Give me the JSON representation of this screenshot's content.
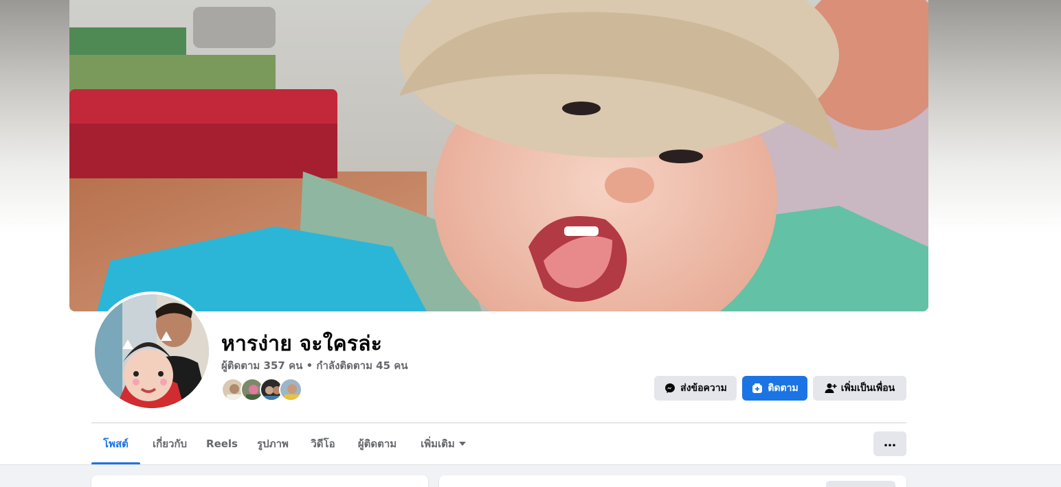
{
  "profile": {
    "name": "หารง่าย จะใครล่ะ",
    "stats": "ผู้ติดตาม 357 คน • กำลังติดตาม 45 คน",
    "friend_faces": [
      {
        "label": "friend-1",
        "color": "#d9c9b4"
      },
      {
        "label": "friend-2",
        "color": "#7c8a6a"
      },
      {
        "label": "friend-3",
        "color": "#2b2b2b"
      },
      {
        "label": "friend-4",
        "color": "#9cb6c8"
      }
    ]
  },
  "actions": {
    "message_label": "ส่งข้อความ",
    "message_icon": "messenger-icon",
    "follow_label": "ติดตาม",
    "follow_icon": "follow-icon",
    "add_friend_label": "เพิ่มเป็นเพื่อน",
    "add_friend_icon": "add-friend-icon"
  },
  "tabs": [
    {
      "label": "โพสต์",
      "active": true
    },
    {
      "label": "เกี่ยวกับ",
      "active": false
    },
    {
      "label": "Reels",
      "active": false
    },
    {
      "label": "รูปภาพ",
      "active": false
    },
    {
      "label": "วิดีโอ",
      "active": false
    },
    {
      "label": "ผู้ติดตาม",
      "active": false
    },
    {
      "label": "เพิ่มเติม",
      "active": false,
      "has_caret": true
    }
  ],
  "more_menu_icon": "more-dots-icon",
  "colors": {
    "accent": "#1b74e4",
    "button_gray": "#e4e6eb",
    "text_primary": "#050505",
    "text_secondary": "#65676b",
    "page_bg": "#f0f2f5"
  }
}
